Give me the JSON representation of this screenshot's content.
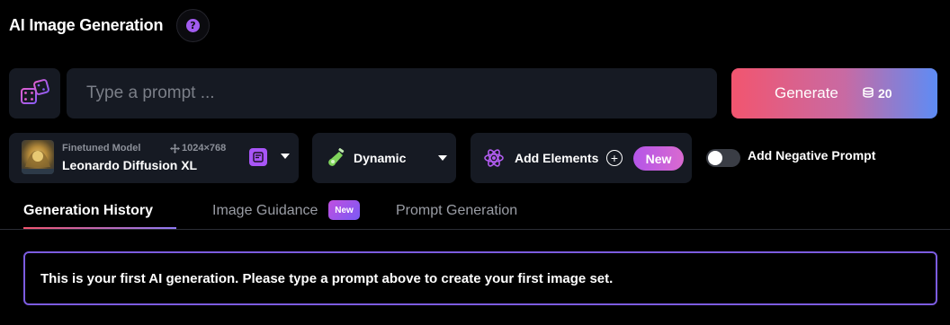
{
  "header": {
    "title": "AI Image Generation",
    "help_glyph": "?",
    "help_icon": "question-icon"
  },
  "prompt": {
    "dice_icon": "dice-icon",
    "placeholder": "Type a prompt ...",
    "value": ""
  },
  "generate": {
    "label": "Generate",
    "token_icon": "coins-icon",
    "tokens": "20",
    "gradient": [
      "#f2556f",
      "#5d8cf5"
    ]
  },
  "model": {
    "sublabel": "Finetuned Model",
    "dimensions": "1024×768",
    "name": "Leonardo Diffusion XL"
  },
  "style": {
    "label": "Dynamic",
    "icon": "potion-icon"
  },
  "elements": {
    "label": "Add Elements",
    "icon": "atom-icon",
    "badge": "New"
  },
  "negative_prompt": {
    "label": "Add Negative Prompt",
    "enabled": false
  },
  "tabs": [
    {
      "label": "Generation History",
      "active": true
    },
    {
      "label": "Image Guidance",
      "badge": "New",
      "active": false
    },
    {
      "label": "Prompt Generation",
      "active": false
    }
  ],
  "notice": {
    "text": "This is your first AI generation. Please type a prompt above to create your first image set."
  },
  "colors": {
    "background": "#000000",
    "card": "#161a23",
    "accent_purple": "#a855f7",
    "notice_border": "#7c5ce0"
  }
}
